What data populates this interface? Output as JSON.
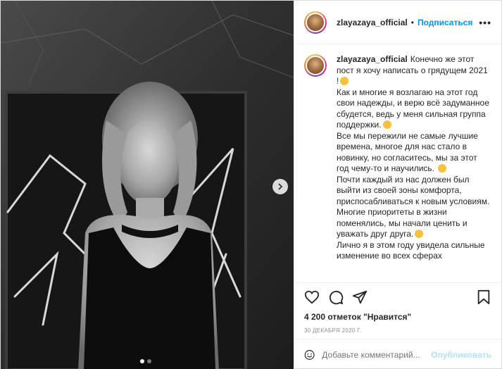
{
  "post": {
    "username": "zlayazaya_official",
    "separator": "•",
    "follow_label": "Подписаться",
    "more_label": "•••"
  },
  "caption": {
    "username": "zlayazaya_official",
    "lines": [
      "Конечно же этот пост я хочу написать о грядущем 2021 !",
      "Как и многие я возлагаю на этот год свои надежды, и верю всё задуманное сбудется, ведь у меня сильная группа поддержки.",
      "Все мы пережили не самые лучшие времена, многое для нас стало в новинку, но согласитесь, мы за этот год чему-то и научились.",
      "Почти каждый из нас должен был выйти из своей зоны комфорта, приспосабливаться к новым условиям.",
      "Многие приоритеты в жизни поменялись, мы начали ценить и уважать друг друга.",
      "Лично я в этом году увидела сильные изменение во всех сферах"
    ]
  },
  "stats": {
    "likes": "4 200 отметок \"Нравится\"",
    "date": "30 ДЕКАБРЯ 2020 Г."
  },
  "comment": {
    "placeholder": "Добавьте комментарий...",
    "post_label": "Опубликовать"
  },
  "carousel": {
    "count": 2,
    "active": 1
  },
  "icons": {
    "like": "heart-icon",
    "comment": "comment-icon",
    "share": "paper-plane-icon",
    "save": "bookmark-icon",
    "emoji": "smiley-icon",
    "next": "chevron-right-icon"
  },
  "colors": {
    "link": "#0095f6",
    "post_disabled": "#b2dffc",
    "muted": "#8e8e8e",
    "text": "#262626"
  }
}
